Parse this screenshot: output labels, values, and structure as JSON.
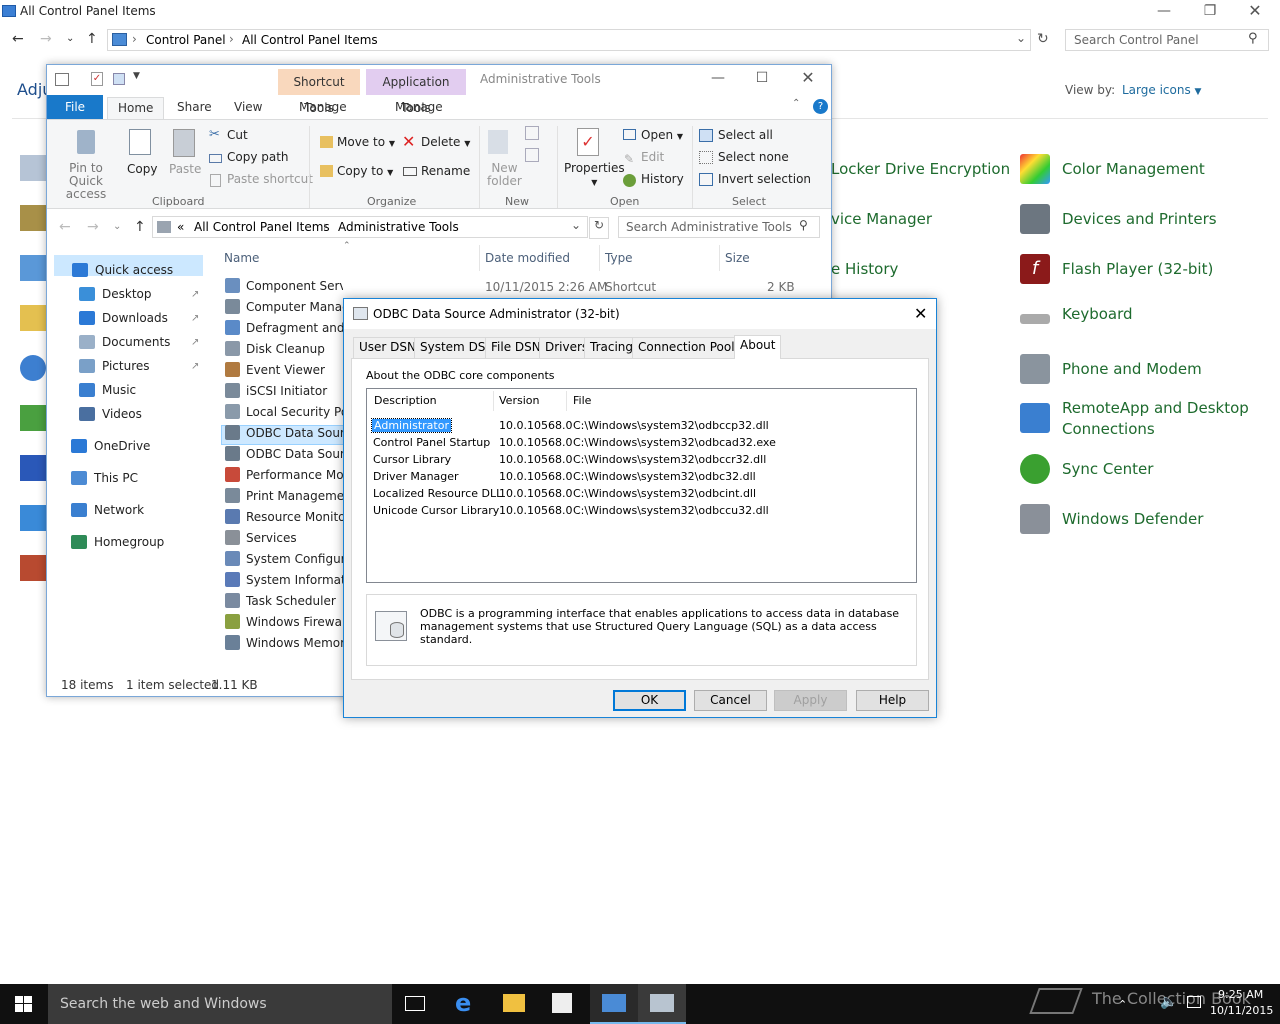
{
  "control_panel": {
    "title": "All Control Panel Items",
    "breadcrumb": [
      "Control Panel",
      "All Control Panel Items"
    ],
    "search_placeholder": "Search Control Panel",
    "adjust_partial": "Adju",
    "view_by_label": "View by:",
    "view_by_value": "Large icons",
    "items_right": [
      "Color Management",
      "Devices and Printers",
      "Flash Player (32-bit)",
      "Keyboard",
      "Phone and Modem",
      "RemoteApp and Desktop Connections",
      "Sync Center",
      "Windows Defender"
    ],
    "items_middle_partial": [
      "Locker Drive Encryption",
      "vice Manager",
      "e History"
    ]
  },
  "explorer": {
    "context_tabs": [
      "Shortcut Tools",
      "Application Tools"
    ],
    "title": "Administrative Tools",
    "ribbon_tabs": [
      "File",
      "Home",
      "Share",
      "View",
      "Manage",
      "Manage"
    ],
    "ribbon": {
      "pin": [
        "Pin to Quick",
        "access"
      ],
      "copy": "Copy",
      "paste": "Paste",
      "cut": "Cut",
      "copy_path": "Copy path",
      "paste_shortcut": "Paste shortcut",
      "move_to": "Move to",
      "copy_to": "Copy to",
      "delete": "Delete",
      "rename": "Rename",
      "new_folder": [
        "New",
        "folder"
      ],
      "properties": "Properties",
      "open": "Open",
      "edit": "Edit",
      "history": "History",
      "select_all": "Select all",
      "select_none": "Select none",
      "invert_selection": "Invert selection",
      "groups": [
        "Clipboard",
        "Organize",
        "New",
        "Open",
        "Select"
      ]
    },
    "address": [
      "«",
      "All Control Panel Items",
      "Administrative Tools"
    ],
    "search_placeholder": "Search Administrative Tools",
    "nav": [
      {
        "label": "Quick access",
        "color": "#2b79d6"
      },
      {
        "label": "Desktop",
        "color": "#3a8fd9",
        "pinned": true
      },
      {
        "label": "Downloads",
        "color": "#2b79d6",
        "pinned": true
      },
      {
        "label": "Documents",
        "color": "#9ab0c8",
        "pinned": true
      },
      {
        "label": "Pictures",
        "color": "#7aa0c8",
        "pinned": true
      },
      {
        "label": "Music",
        "color": "#3a7fd0"
      },
      {
        "label": "Videos",
        "color": "#4a6fa0"
      },
      {
        "label": "OneDrive",
        "color": "#2b79d6"
      },
      {
        "label": "This PC",
        "color": "#4c8bd4"
      },
      {
        "label": "Network",
        "color": "#3a7fd0"
      },
      {
        "label": "Homegroup",
        "color": "#2e8b57"
      }
    ],
    "columns": [
      "Name",
      "Date modified",
      "Type",
      "Size"
    ],
    "first_row": {
      "date": "10/11/2015 2:26 AM",
      "type": "Shortcut",
      "size": "2 KB"
    },
    "files": [
      "Component Services",
      "Computer Management",
      "Defragment and Optimize Drives",
      "Disk Cleanup",
      "Event Viewer",
      "iSCSI Initiator",
      "Local Security Policy",
      "ODBC Data Sources (32-bit)",
      "ODBC Data Sources (64-bit)",
      "Performance Monitor",
      "Print Management",
      "Resource Monitor",
      "Services",
      "System Configuration",
      "System Information",
      "Task Scheduler",
      "Windows Firewall with Advanced Security",
      "Windows Memory Diagnostic"
    ],
    "status": {
      "items": "18 items",
      "selected": "1 item selected",
      "size": "1.11 KB"
    }
  },
  "dialog": {
    "title": "ODBC Data Source Administrator (32-bit)",
    "tabs": [
      "User DSN",
      "System DSN",
      "File DSN",
      "Drivers",
      "Tracing",
      "Connection Pooling",
      "About"
    ],
    "section_label": "About the ODBC core components",
    "columns": [
      "Description",
      "Version",
      "File"
    ],
    "rows": [
      {
        "desc": "Administrator",
        "version": "10.0.10568.0",
        "file": "C:\\Windows\\system32\\odbccp32.dll"
      },
      {
        "desc": "Control Panel Startup",
        "version": "10.0.10568.0",
        "file": "C:\\Windows\\system32\\odbcad32.exe"
      },
      {
        "desc": "Cursor Library",
        "version": "10.0.10568.0",
        "file": "C:\\Windows\\system32\\odbccr32.dll"
      },
      {
        "desc": "Driver Manager",
        "version": "10.0.10568.0",
        "file": "C:\\Windows\\system32\\odbc32.dll"
      },
      {
        "desc": "Localized Resource DLL",
        "version": "10.0.10568.0",
        "file": "C:\\Windows\\system32\\odbcint.dll"
      },
      {
        "desc": "Unicode Cursor Library",
        "version": "10.0.10568.0",
        "file": "C:\\Windows\\system32\\odbccu32.dll"
      }
    ],
    "info": "ODBC is a programming interface that enables applications to access data in database management systems that use Structured Query Language (SQL) as a data access standard.",
    "buttons": [
      "OK",
      "Cancel",
      "Apply",
      "Help"
    ]
  },
  "taskbar": {
    "search_placeholder": "Search the web and Windows",
    "time": "9:25 AM",
    "date": "10/11/2015",
    "watermark": "The Collection Book"
  }
}
